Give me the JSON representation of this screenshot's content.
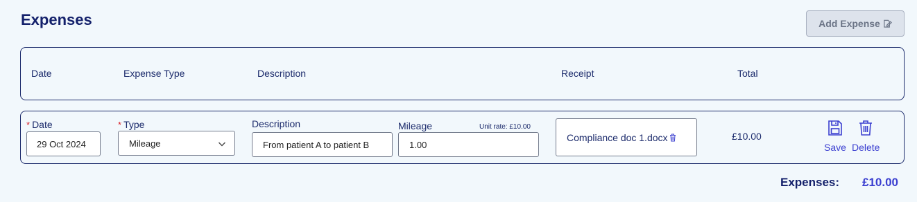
{
  "page": {
    "title": "Expenses",
    "add_button_label": "Add Expense"
  },
  "table_header": {
    "date": "Date",
    "expense_type": "Expense Type",
    "description": "Description",
    "receipt": "Receipt",
    "total": "Total"
  },
  "row": {
    "date_label": "Date",
    "date_value": "29 Oct 2024",
    "type_label": "Type",
    "type_value": "Mileage",
    "description_label": "Description",
    "description_value": "From patient A to patient B",
    "mileage_label": "Mileage",
    "unit_rate": "Unit rate: £10.00",
    "mileage_value": "1.00",
    "receipt_file": "Compliance doc 1.docx",
    "total": "£10.00",
    "save_label": "Save",
    "delete_label": "Delete",
    "required_mark": "*"
  },
  "summary": {
    "label": "Expenses:",
    "value": "£10.00"
  },
  "colors": {
    "primary": "#1b2a6b",
    "accent": "#3b3fd0",
    "required": "#d9262e",
    "background": "#f2f8fc"
  },
  "icons": {
    "add": "edit-document-icon",
    "select": "chevron-down-icon",
    "receipt_remove": "trash-icon",
    "save": "floppy-disk-icon",
    "delete": "trash-icon"
  }
}
